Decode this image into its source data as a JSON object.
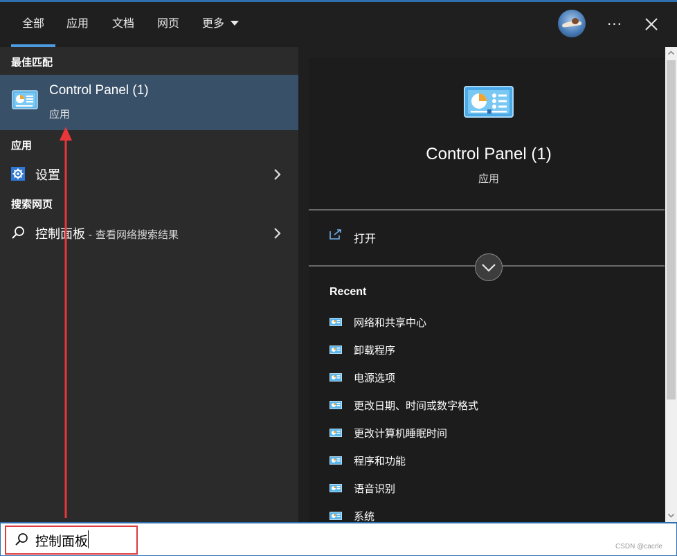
{
  "tabs": [
    {
      "label": "全部",
      "active": true
    },
    {
      "label": "应用",
      "active": false
    },
    {
      "label": "文档",
      "active": false
    },
    {
      "label": "网页",
      "active": false
    },
    {
      "label": "更多",
      "active": false
    }
  ],
  "header": {
    "more_menu_label": "···",
    "close_label": "close"
  },
  "left": {
    "best_match_heading": "最佳匹配",
    "best_match": {
      "title": "Control Panel (1)",
      "subtitle": "应用",
      "icon": "control-panel-icon"
    },
    "apps_heading": "应用",
    "apps": [
      {
        "label": "设置",
        "icon": "gear-icon"
      }
    ],
    "web_heading": "搜索网页",
    "web": [
      {
        "query": "控制面板",
        "suffix": " - 查看网络搜索结果",
        "icon": "search-icon"
      }
    ]
  },
  "right": {
    "title": "Control Panel (1)",
    "subtitle": "应用",
    "open_label": "打开",
    "recent_heading": "Recent",
    "recent_items": [
      "网络和共享中心",
      "卸载程序",
      "电源选项",
      "更改日期、时间或数字格式",
      "更改计算机睡眠时间",
      "程序和功能",
      "语音识别",
      "系统"
    ]
  },
  "search": {
    "value": "控制面板"
  },
  "watermark": "CSDN @cacrle",
  "colors": {
    "accent": "#4c9ae0",
    "selection": "#385068",
    "highlight_box": "#e0393b",
    "annotation_arrow": "#e8373b"
  }
}
